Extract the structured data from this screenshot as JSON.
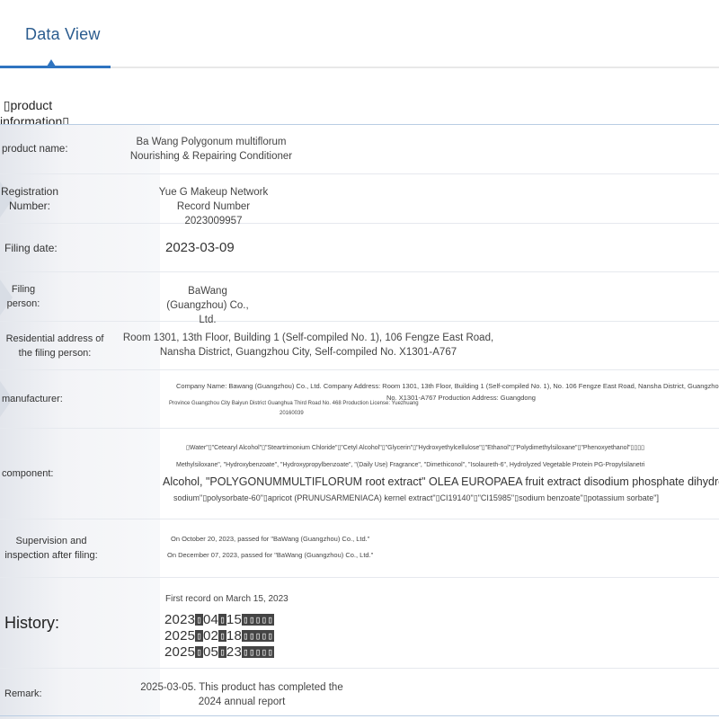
{
  "tabs": {
    "active_label": "Data View"
  },
  "section": {
    "title": "▯product information▯"
  },
  "rows": {
    "product_name": {
      "label": "product name:",
      "value": "Ba Wang Polygonum multiflorum Nourishing & Repairing Conditioner"
    },
    "registration": {
      "label": "Registration Number:",
      "value": "Yue G Makeup Network Record Number 2023009957"
    },
    "filing_date": {
      "label": "Filing date:",
      "value": "2023-03-09"
    },
    "filing_person": {
      "label": "Filing person:",
      "value": "BaWang (Guangzhou) Co., Ltd."
    },
    "residential": {
      "label": "Residential address of the filing person:",
      "value": "Room 1301, 13th Floor, Building 1 (Self-compiled No. 1), 106 Fengze East Road, Nansha District, Guangzhou City, Self-compiled No. X1301-A767"
    },
    "manufacturer": {
      "label": "manufacturer:",
      "line1": "Company Name: Bawang (Guangzhou) Co., Ltd. Company Address: Room 1301, 13th Floor, Building 1 (Self-compiled No. 1), No. 106 Fengze East Road, Nansha District, Guangzhou City Self-comp",
      "line2": "No. X1301-A767 Production Address: Guangdong",
      "line3": "Province Guangzhou City Baiyun District Guanghua Third Road No. 468 Production License: Yuezhuang",
      "line4": "20160039"
    },
    "component": {
      "label": "component:",
      "line1": "▯Water\"▯\"Cetearyl Alcohol\"▯\"Steartrimonium Chloride\"▯\"Cetyl Alcohol\"▯\"Glycerin\"▯\"Hydroxyethylcellulose\"▯\"Ethanol\"▯\"Polydimethylsiloxane\"▯\"Phenoxyethanol\"▯▯▯▯",
      "line2": "Methylsiloxane\", \"Hydroxybenzoate\", \"Hydroxypropylbenzoate\", \"(Daily Use) Fragrance\", \"Dimethiconol\", \"Isolaureth-6\", Hydrolyzed Vegetable Protein PG-Propylsilanetri",
      "line3": "Alcohol, \"POLYGONUMMULTIFLORUM root extract\" OLEA EUROPAEA fruit extract disodium phosphate dihydrogen phosphate",
      "line4": "sodium\"▯polysorbate-60\"▯apricot (PRUNUSARMENIACA) kernel extract\"▯CI19140\"▯\"CI15985\"▯sodium benzoate\"▯potassium sorbate\"]"
    },
    "supervision": {
      "label": "Supervision and inspection after filing:",
      "line1": "On October 20, 2023, passed for \"BaWang (Guangzhou) Co., Ltd.\"",
      "line2": "On December 07, 2023, passed for \"BaWang (Guangzhou) Co., Ltd.\""
    },
    "history": {
      "label": "History:",
      "first": "First record on March 15, 2023",
      "entries": [
        {
          "y": "2023",
          "m": "04",
          "d": "15"
        },
        {
          "y": "2025",
          "m": "02",
          "d": "18"
        },
        {
          "y": "2025",
          "m": "05",
          "d": "23"
        }
      ],
      "box": "▯",
      "suffix": "▯▯▯▯▯"
    },
    "remark": {
      "label": "Remark:",
      "value": "2025-03-05. This product has completed the 2024 annual report"
    }
  },
  "colors": {
    "accent": "#2f74c0",
    "tab_text": "#2b5c8f",
    "row_border": "#e6e9ee"
  }
}
